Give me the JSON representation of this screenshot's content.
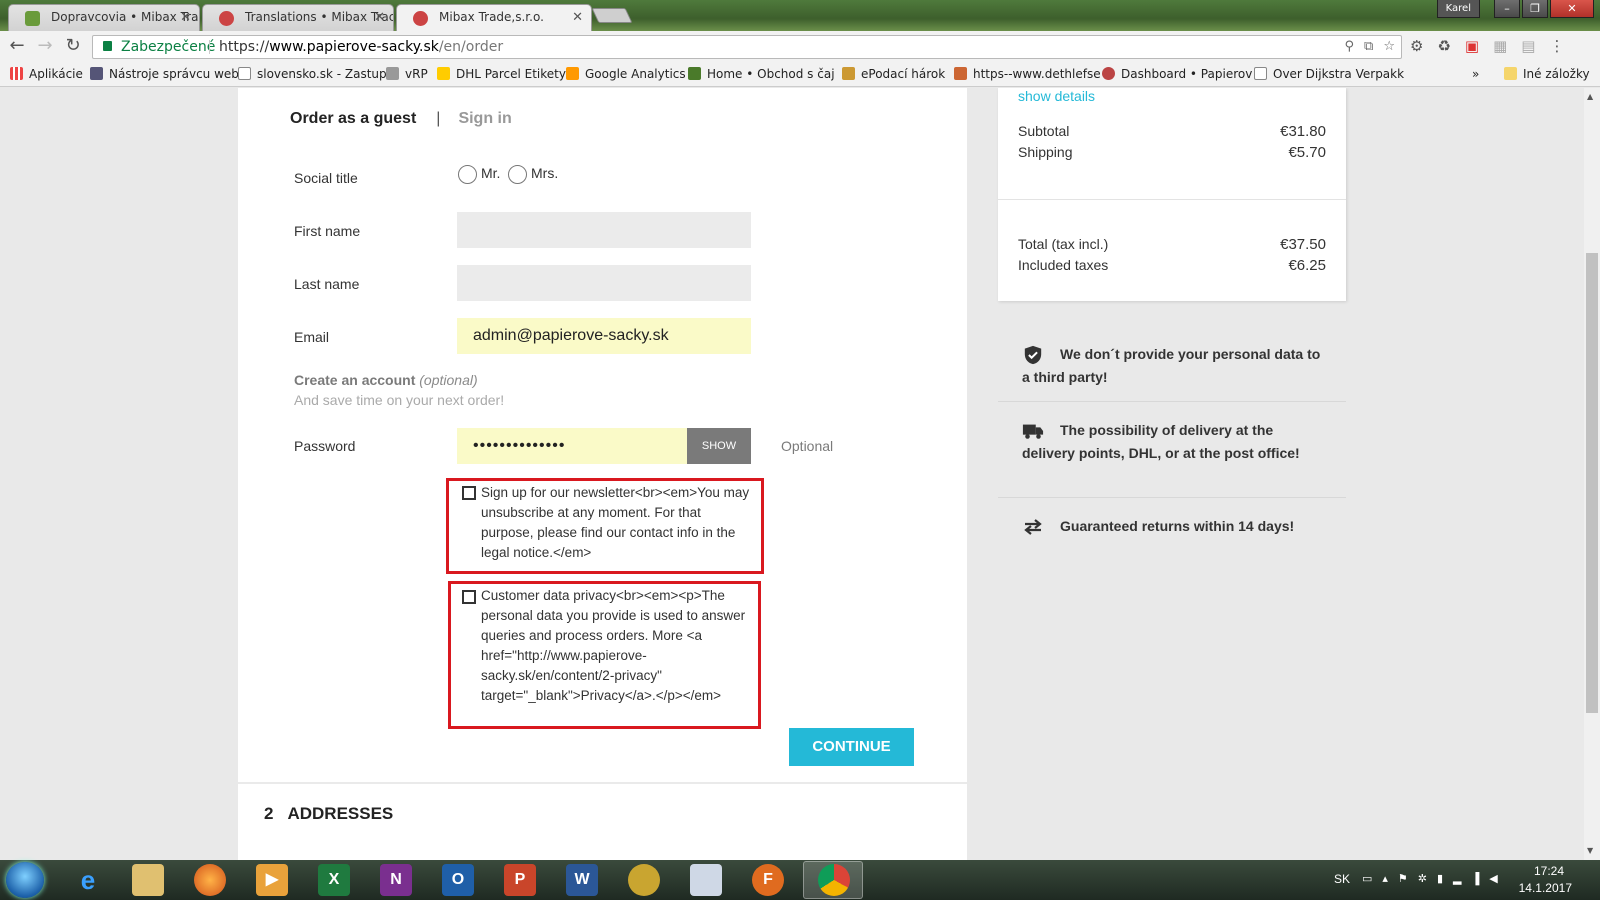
{
  "browser": {
    "tabs": [
      {
        "title": "Dopravcovia • Mibax Tra",
        "active": false
      },
      {
        "title": "Translations • Mibax Trac",
        "active": false
      },
      {
        "title": "Mibax Trade,s.r.o.",
        "active": true
      }
    ],
    "user": "Karel",
    "secure_label": "Zabezpečené",
    "url_scheme": "https://",
    "url_host": "www.papierove-sacky.sk",
    "url_path": "/en/order"
  },
  "bookmarks": {
    "items": [
      "Aplikácie",
      "Nástroje správcu web",
      "slovensko.sk - Zastup",
      "vRP",
      "DHL Parcel Etikety",
      "Google Analytics",
      "Home • Obchod s čaj",
      "ePodací hárok",
      "https--www.dethlefse",
      "Dashboard • Papierov",
      "Over Dijkstra Verpakk"
    ],
    "more": "»",
    "other": "Iné záložky"
  },
  "form": {
    "tab_guest": "Order as a guest",
    "tab_sep": "|",
    "tab_signin": "Sign in",
    "social_title_label": "Social title",
    "mr": "Mr.",
    "mrs": "Mrs.",
    "first_name_label": "First name",
    "first_name_value": "",
    "last_name_label": "Last name",
    "last_name_value": "",
    "email_label": "Email",
    "email_value": "admin@papierove-sacky.sk",
    "create_account_bold": "Create an account",
    "create_account_optional": "(optional)",
    "create_account_sub": "And save time on your next order!",
    "password_label": "Password",
    "password_value": "••••••••••••••",
    "show_button": "SHOW",
    "optional_label": "Optional",
    "newsletter_text": "Sign up for our newsletter<br><em>You may unsubscribe at any moment. For that purpose, please find our contact info in the legal notice.</em>",
    "privacy_text": "Customer data privacy<br><em><p>The personal data you provide is used to answer queries and process orders. More <a href=\"http://www.papierove-sacky.sk/en/content/2-privacy\" target=\"_blank\">Privacy</a>.</p></em>",
    "continue_button": "CONTINUE",
    "addresses_num": "2",
    "addresses_label": "ADDRESSES"
  },
  "summary": {
    "show_details": "show details",
    "subtotal_label": "Subtotal",
    "subtotal_value": "€31.80",
    "shipping_label": "Shipping",
    "shipping_value": "€5.70",
    "total_label": "Total (tax incl.)",
    "total_value": "€37.50",
    "taxes_label": "Included taxes",
    "taxes_value": "€6.25"
  },
  "reassurance": [
    {
      "icon": "shield-check-icon",
      "text": "We don´t provide your personal data to a third party!"
    },
    {
      "icon": "truck-icon",
      "text": "The possibility of delivery at the delivery points, DHL, or at the post office!"
    },
    {
      "icon": "exchange-arrows-icon",
      "text": "Guaranteed returns within 14 days!"
    }
  ],
  "taskbar": {
    "lang": "SK",
    "time": "17:24",
    "date": "14.1.2017"
  },
  "colors": {
    "accent": "#24b9d7",
    "highlight_border": "#d9181f",
    "autofill": "#fafac8"
  }
}
